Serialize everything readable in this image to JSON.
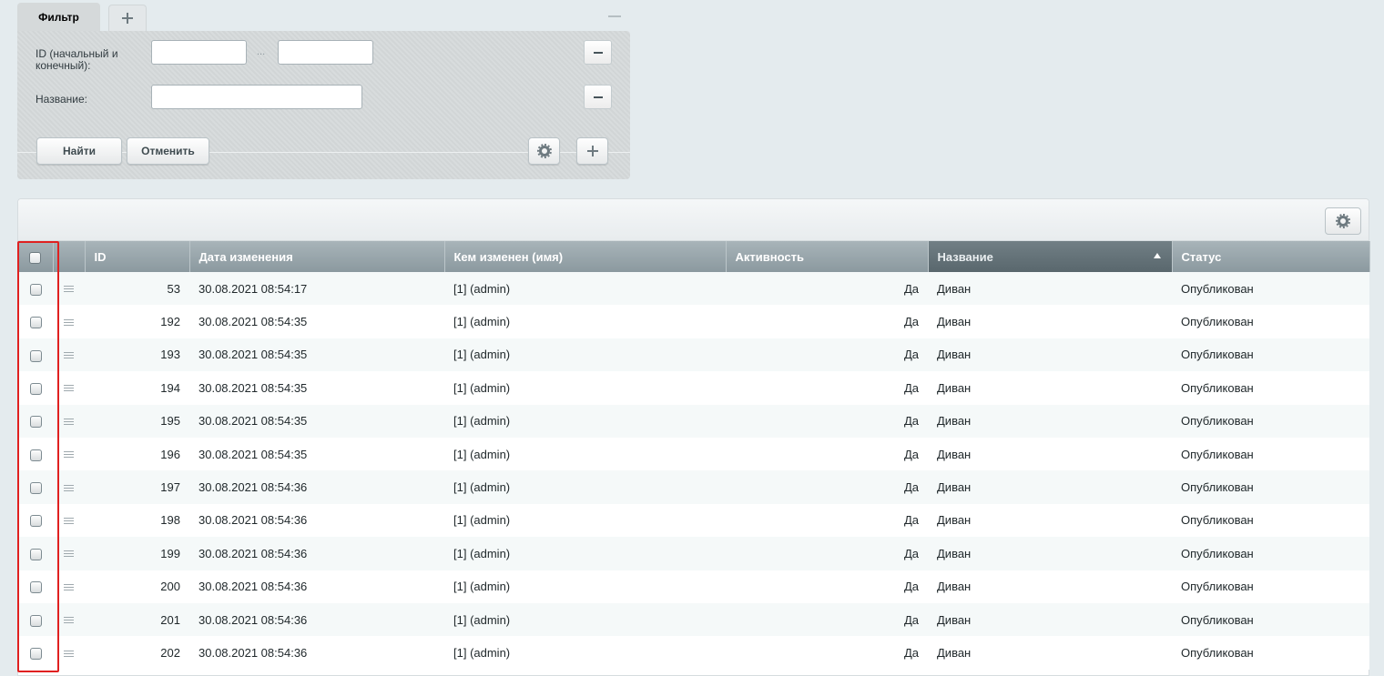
{
  "filter": {
    "tab_label": "Фильтр",
    "id_label": "ID (начальный и конечный):",
    "id_from_value": "",
    "id_to_value": "",
    "range_separator": "...",
    "name_label": "Название:",
    "name_value": "",
    "find_label": "Найти",
    "cancel_label": "Отменить"
  },
  "grid": {
    "columns": [
      {
        "label": "ID"
      },
      {
        "label": "Дата изменения"
      },
      {
        "label": "Кем изменен (имя)"
      },
      {
        "label": "Активность"
      },
      {
        "label": "Название",
        "sorted": "asc"
      },
      {
        "label": "Статус"
      }
    ],
    "rows": [
      {
        "id": "53",
        "date": "30.08.2021 08:54:17",
        "user": "[1] (admin)",
        "active": "Да",
        "name": "Диван",
        "status": "Опубликован"
      },
      {
        "id": "192",
        "date": "30.08.2021 08:54:35",
        "user": "[1] (admin)",
        "active": "Да",
        "name": "Диван",
        "status": "Опубликован"
      },
      {
        "id": "193",
        "date": "30.08.2021 08:54:35",
        "user": "[1] (admin)",
        "active": "Да",
        "name": "Диван",
        "status": "Опубликован"
      },
      {
        "id": "194",
        "date": "30.08.2021 08:54:35",
        "user": "[1] (admin)",
        "active": "Да",
        "name": "Диван",
        "status": "Опубликован"
      },
      {
        "id": "195",
        "date": "30.08.2021 08:54:35",
        "user": "[1] (admin)",
        "active": "Да",
        "name": "Диван",
        "status": "Опубликован"
      },
      {
        "id": "196",
        "date": "30.08.2021 08:54:35",
        "user": "[1] (admin)",
        "active": "Да",
        "name": "Диван",
        "status": "Опубликован"
      },
      {
        "id": "197",
        "date": "30.08.2021 08:54:36",
        "user": "[1] (admin)",
        "active": "Да",
        "name": "Диван",
        "status": "Опубликован"
      },
      {
        "id": "198",
        "date": "30.08.2021 08:54:36",
        "user": "[1] (admin)",
        "active": "Да",
        "name": "Диван",
        "status": "Опубликован"
      },
      {
        "id": "199",
        "date": "30.08.2021 08:54:36",
        "user": "[1] (admin)",
        "active": "Да",
        "name": "Диван",
        "status": "Опубликован"
      },
      {
        "id": "200",
        "date": "30.08.2021 08:54:36",
        "user": "[1] (admin)",
        "active": "Да",
        "name": "Диван",
        "status": "Опубликован"
      },
      {
        "id": "201",
        "date": "30.08.2021 08:54:36",
        "user": "[1] (admin)",
        "active": "Да",
        "name": "Диван",
        "status": "Опубликован"
      },
      {
        "id": "202",
        "date": "30.08.2021 08:54:36",
        "user": "[1] (admin)",
        "active": "Да",
        "name": "Диван",
        "status": "Опубликован"
      }
    ]
  },
  "colors": {
    "highlight": "#e02020",
    "header": "#8b999f",
    "sorted_header": "#59676d"
  }
}
